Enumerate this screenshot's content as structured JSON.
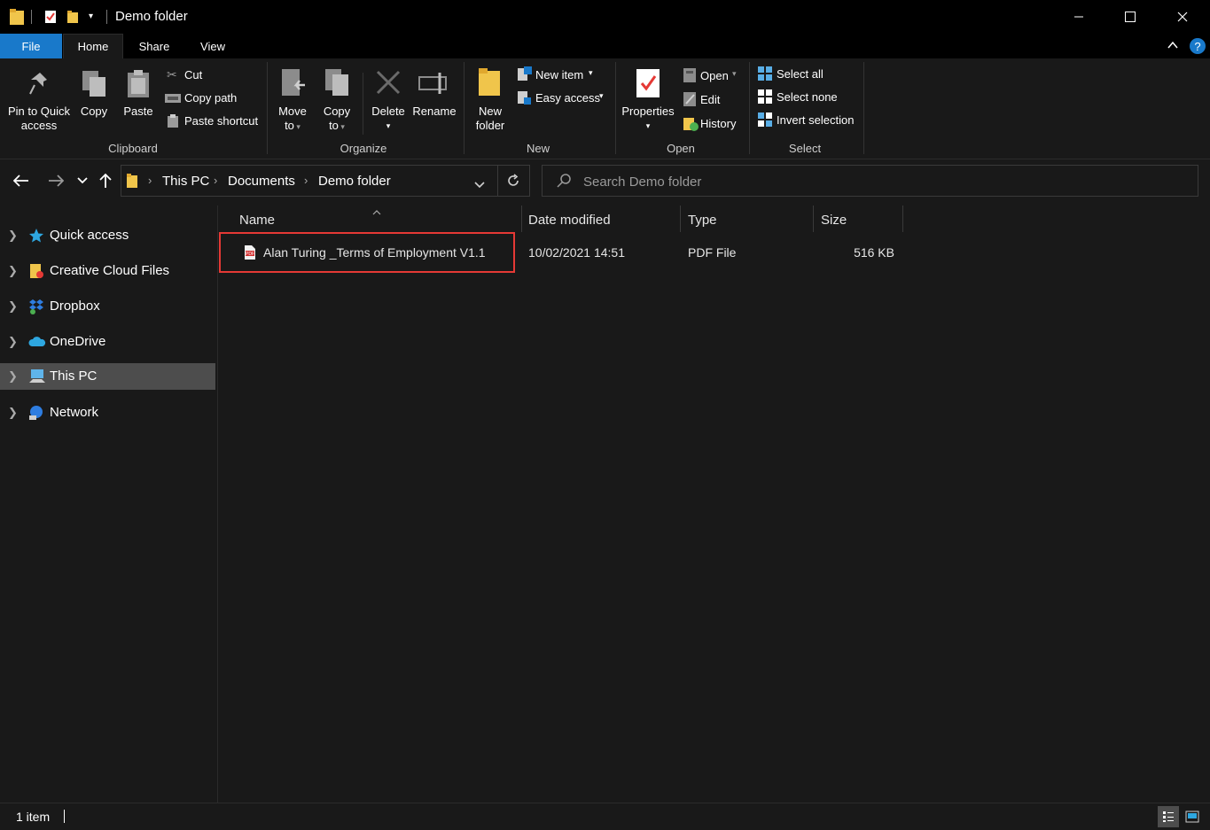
{
  "window": {
    "title": "Demo folder",
    "minimize_icon": "minimize-icon",
    "maximize_icon": "maximize-icon",
    "close_icon": "close-icon"
  },
  "ribbon_tabs": [
    {
      "label": "File"
    },
    {
      "label": "Home"
    },
    {
      "label": "Share"
    },
    {
      "label": "View"
    }
  ],
  "ribbon": {
    "clipboard": {
      "group": "Clipboard",
      "pin_line1": "Pin to Quick",
      "pin_line2": "access",
      "copy": "Copy",
      "paste": "Paste",
      "cut": "Cut",
      "copy_path": "Copy path",
      "paste_shortcut": "Paste shortcut"
    },
    "organize": {
      "group": "Organize",
      "move_line1": "Move",
      "move_line2": "to",
      "copy_line1": "Copy",
      "copy_line2": "to",
      "delete": "Delete",
      "rename": "Rename"
    },
    "new": {
      "group": "New",
      "folder_line1": "New",
      "folder_line2": "folder",
      "new_item": "New item",
      "easy_access": "Easy access"
    },
    "open": {
      "group": "Open",
      "properties": "Properties",
      "open": "Open",
      "edit": "Edit",
      "history": "History"
    },
    "select": {
      "group": "Select",
      "select_all": "Select all",
      "select_none": "Select none",
      "invert_selection": "Invert selection"
    }
  },
  "address": {
    "crumbs": [
      "This PC",
      "Documents",
      "Demo folder"
    ]
  },
  "search": {
    "placeholder": "Search Demo folder"
  },
  "nav": [
    {
      "label": "Quick access",
      "icon": "star-icon"
    },
    {
      "label": "Creative Cloud Files",
      "icon": "creative-cloud-folder-icon"
    },
    {
      "label": "Dropbox",
      "icon": "dropbox-icon"
    },
    {
      "label": "OneDrive",
      "icon": "onedrive-cloud-icon"
    },
    {
      "label": "This PC",
      "icon": "computer-icon"
    },
    {
      "label": "Network",
      "icon": "network-icon"
    }
  ],
  "columns": {
    "name": "Name",
    "date": "Date modified",
    "type": "Type",
    "size": "Size"
  },
  "files": [
    {
      "name": "Alan Turing _Terms of Employment V1.1",
      "date": "10/02/2021 14:51",
      "type": "PDF File",
      "size": "516 KB",
      "icon": "pdf-icon"
    }
  ],
  "status": {
    "count": "1 item"
  },
  "colors": {
    "accent": "#1979ca",
    "selection": "#4d4d4d",
    "highlight": "#e53935",
    "background": "#191919"
  }
}
